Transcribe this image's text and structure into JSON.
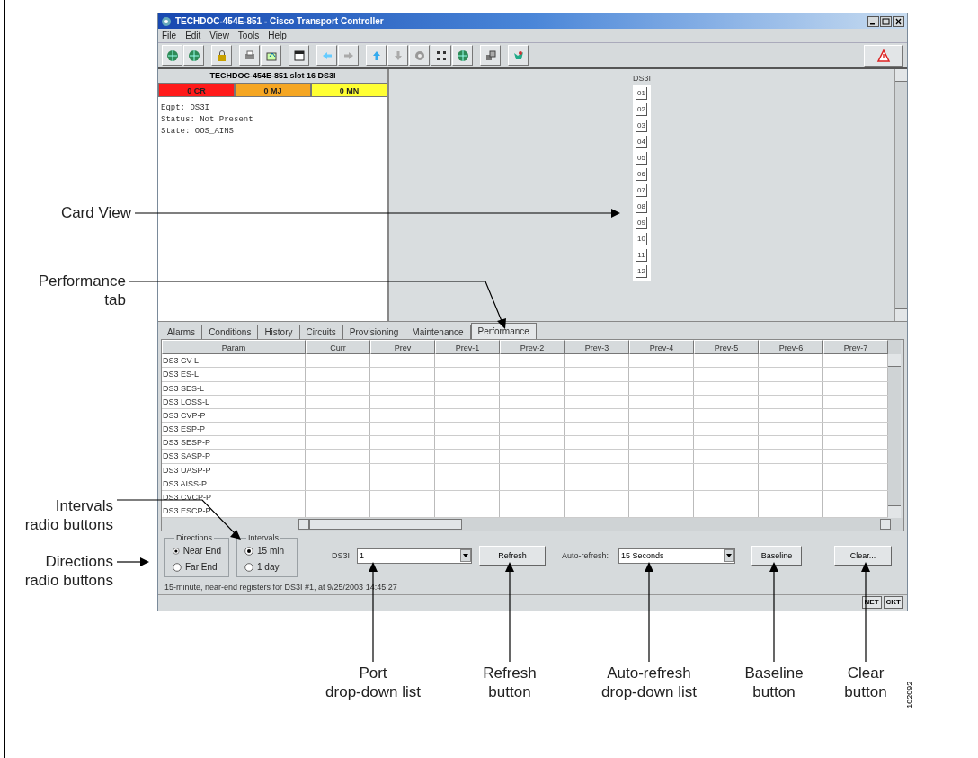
{
  "window": {
    "title": "TECHDOC-454E-851 - Cisco Transport Controller"
  },
  "menu": [
    "File",
    "Edit",
    "View",
    "Tools",
    "Help"
  ],
  "card_panel": {
    "title": "TECHDOC-454E-851 slot 16 DS3I",
    "alarms": [
      {
        "label": "0 CR",
        "color": "#ff1a1a"
      },
      {
        "label": "0 MJ",
        "color": "#f5a623"
      },
      {
        "label": "0 MN",
        "color": "#ffff33"
      }
    ],
    "details": [
      "Eqpt: DS3I",
      "Status: Not Present",
      "State: OOS_AINS"
    ]
  },
  "card_view": {
    "label": "DS3I",
    "ports": [
      "01",
      "02",
      "03",
      "04",
      "05",
      "06",
      "07",
      "08",
      "09",
      "10",
      "11",
      "12"
    ]
  },
  "tabs": [
    {
      "label": "Alarms",
      "selected": false
    },
    {
      "label": "Conditions",
      "selected": false
    },
    {
      "label": "History",
      "selected": false
    },
    {
      "label": "Circuits",
      "selected": false
    },
    {
      "label": "Provisioning",
      "selected": false
    },
    {
      "label": "Maintenance",
      "selected": false
    },
    {
      "label": "Performance",
      "selected": true
    }
  ],
  "table": {
    "columns": [
      "Param",
      "Curr",
      "Prev",
      "Prev-1",
      "Prev-2",
      "Prev-3",
      "Prev-4",
      "Prev-5",
      "Prev-6",
      "Prev-7"
    ],
    "rows": [
      "DS3 CV-L",
      "DS3 ES-L",
      "DS3 SES-L",
      "DS3 LOSS-L",
      "DS3 CVP-P",
      "DS3 ESP-P",
      "DS3 SESP-P",
      "DS3 SASP-P",
      "DS3 UASP-P",
      "DS3 AISS-P",
      "DS3 CVCP-P",
      "DS3 ESCP-P"
    ]
  },
  "directions": {
    "title": "Directions",
    "options": [
      {
        "label": "Near End",
        "selected": true
      },
      {
        "label": "Far End",
        "selected": false
      }
    ]
  },
  "intervals": {
    "title": "Intervals",
    "options": [
      {
        "label": "15 min",
        "selected": true
      },
      {
        "label": "1 day",
        "selected": false
      }
    ]
  },
  "port": {
    "label": "DS3I",
    "value": "1"
  },
  "refresh_button": "Refresh",
  "auto_refresh": {
    "label": "Auto-refresh:",
    "value": "15 Seconds"
  },
  "buttons": [
    "Baseline",
    "Clear..."
  ],
  "status_message": "15-minute, near-end registers for DS3I #1, at 9/25/2003 14:45:27",
  "status_bar": [
    "NET",
    "CKT"
  ],
  "callouts": [
    "Card View",
    "Performance\ntab",
    "Intervals\nradio buttons",
    "Directions\nradio buttons",
    "Port\ndrop-down list",
    "Refresh\nbutton",
    "Auto-refresh\ndrop-down list",
    "Baseline\nbutton",
    "Clear\nbutton"
  ],
  "figure_number": "102092"
}
